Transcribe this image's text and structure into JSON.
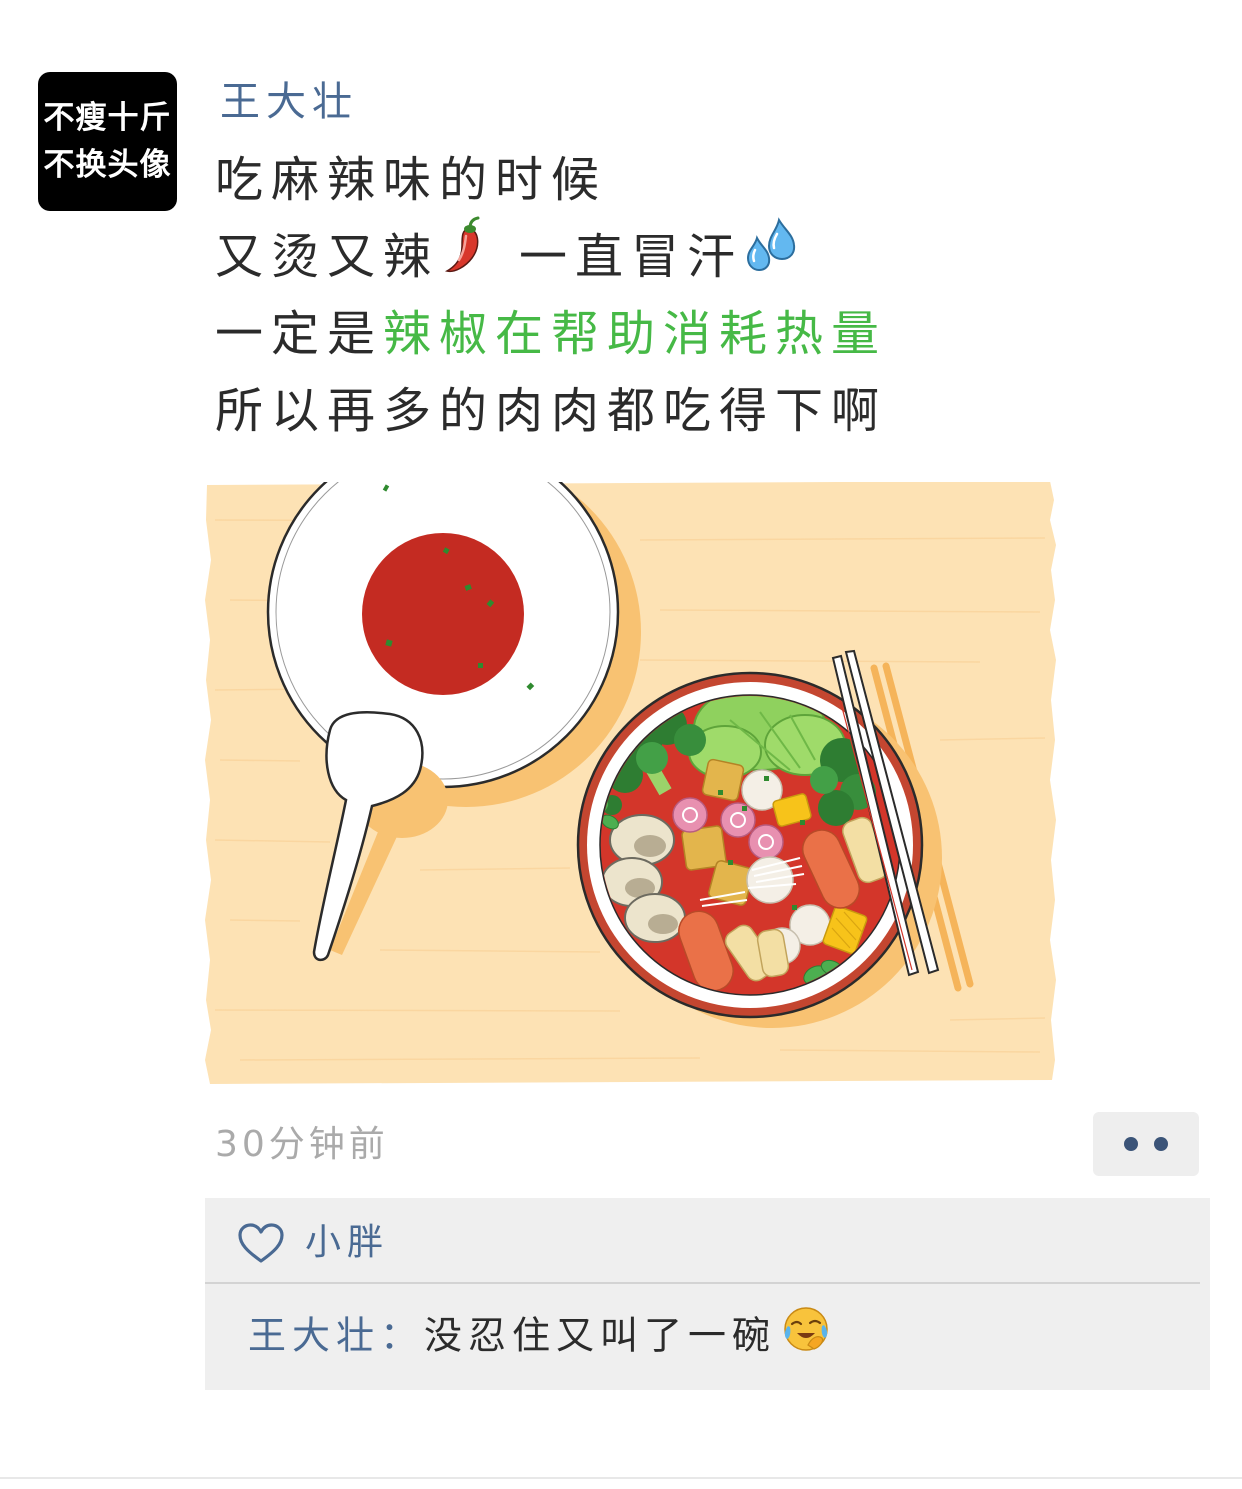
{
  "avatar": {
    "line1": "不瘦十斤",
    "line2": "不换头像"
  },
  "post": {
    "author": "王大壮",
    "lines": [
      {
        "text": "吃麻辣味的时候"
      },
      {
        "text_a": "又烫又辣",
        "icon_a": "chili-pepper-icon",
        "text_b": "一直冒汗",
        "icon_b": "sweat-droplets-icon"
      },
      {
        "text": "一定是",
        "highlight": "辣椒在帮助消耗热量"
      },
      {
        "text": "所以再多的肉肉都吃得下啊"
      }
    ],
    "timestamp": "30分钟前",
    "more_button_icon": "more-dots-icon",
    "likes": {
      "icon": "heart-outline-icon",
      "names": [
        "小胖"
      ]
    },
    "comments": [
      {
        "author": "王大壮",
        "separator": "：",
        "text": "没忍住又叫了一碗",
        "emoji": "facepalm-crying-icon"
      }
    ]
  },
  "colors": {
    "author_blue": "#4a6a93",
    "highlight_green": "#46b946",
    "text": "#2b2b2b",
    "timestamp_gray": "#aaaaaa",
    "comment_bg": "#efefef",
    "more_dots": "#3b5478"
  }
}
